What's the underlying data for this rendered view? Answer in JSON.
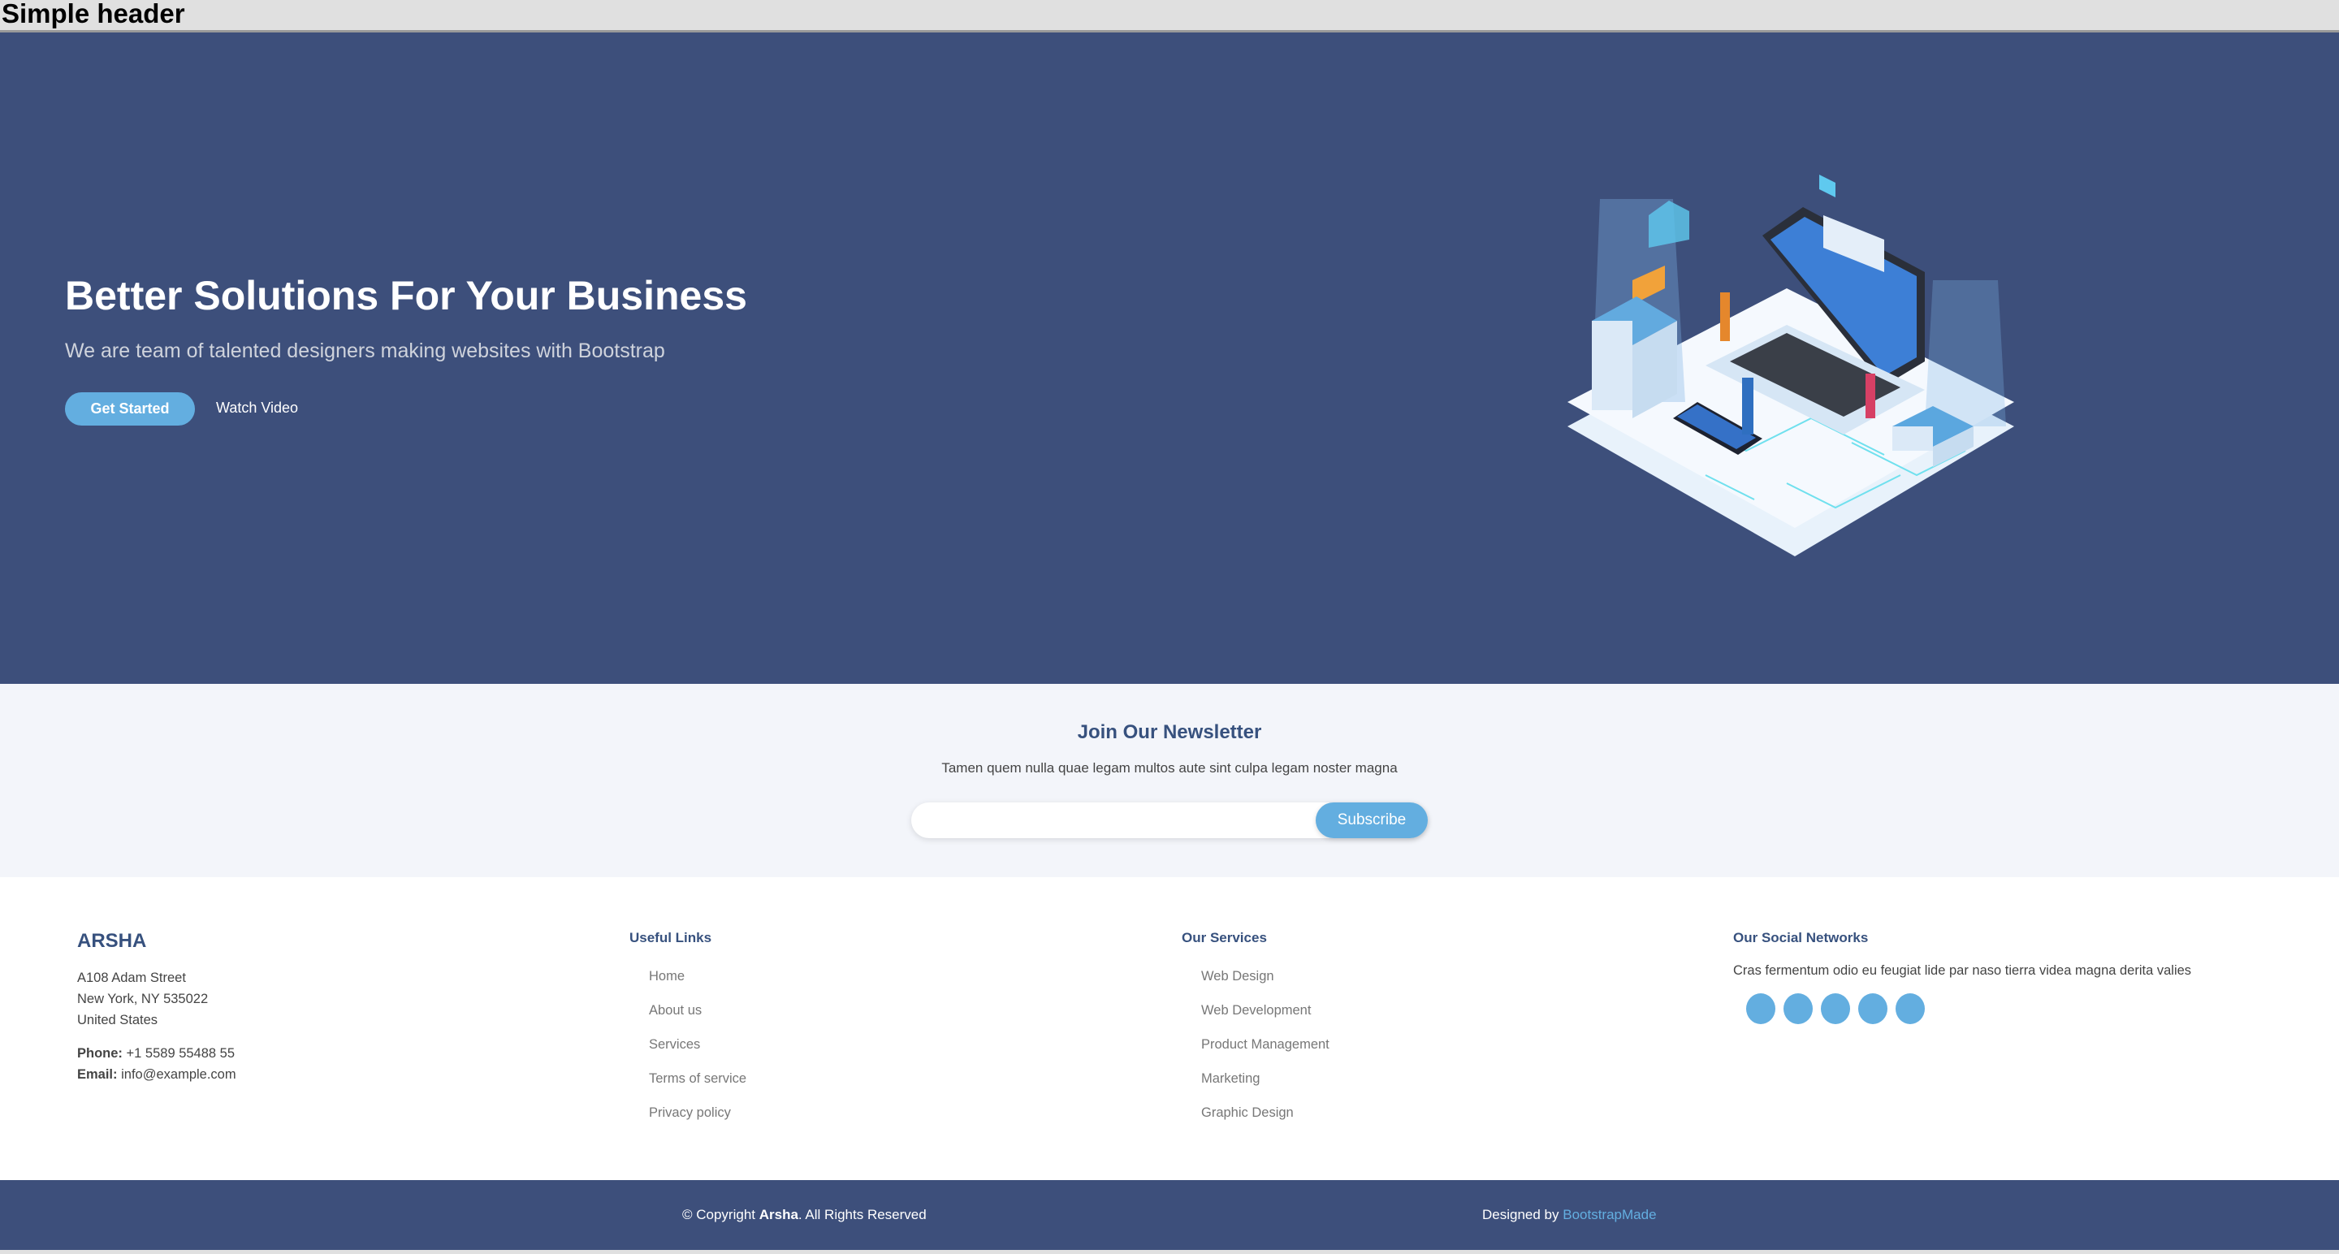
{
  "header": {
    "title": "Simple header"
  },
  "hero": {
    "title": "Better Solutions For Your Business",
    "subtitle": "We are team of talented designers making websites with Bootstrap",
    "get_started": "Get Started",
    "watch_video": "Watch Video"
  },
  "newsletter": {
    "title": "Join Our Newsletter",
    "text": "Tamen quem nulla quae legam multos aute sint culpa legam noster magna",
    "email_value": "",
    "subscribe": "Subscribe"
  },
  "footer": {
    "brand": "ARSHA",
    "address": [
      "A108 Adam Street",
      "New York, NY 535022",
      "United States"
    ],
    "phone_label": "Phone:",
    "phone": "+1 5589 55488 55",
    "email_label": "Email:",
    "email": "info@example.com",
    "useful_links": {
      "title": "Useful Links",
      "items": [
        "Home",
        "About us",
        "Services",
        "Terms of service",
        "Privacy policy"
      ]
    },
    "services": {
      "title": "Our Services",
      "items": [
        "Web Design",
        "Web Development",
        "Product Management",
        "Marketing",
        "Graphic Design"
      ]
    },
    "social": {
      "title": "Our Social Networks",
      "text": "Cras fermentum odio eu feugiat lide par naso tierra videa magna derita valies",
      "icons": [
        "twitter-icon",
        "facebook-icon",
        "instagram-icon",
        "skype-icon",
        "linkedin-icon"
      ]
    }
  },
  "bottom": {
    "copyright_prefix": "© Copyright ",
    "copyright_brand": "Arsha",
    "copyright_suffix": ". All Rights Reserved",
    "designed_by": "Designed by ",
    "designer": "BootstrapMade"
  },
  "colors": {
    "primary": "#3d4f7b",
    "accent": "#63aee0",
    "heading": "#37517e"
  }
}
